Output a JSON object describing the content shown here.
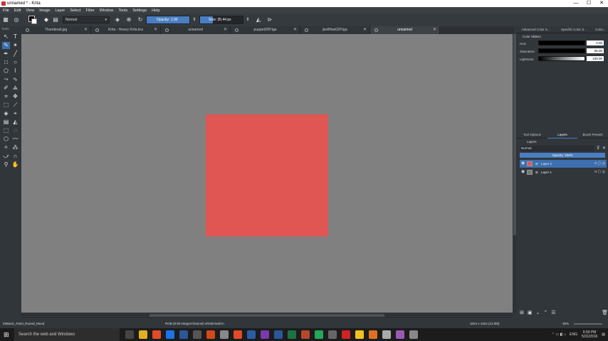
{
  "window": {
    "title": "unnamed * - Krita",
    "minimize": "—",
    "maximize": "☐",
    "close": "✕"
  },
  "menu": [
    "File",
    "Edit",
    "View",
    "Image",
    "Layer",
    "Select",
    "Filter",
    "Window",
    "Tools",
    "Settings",
    "Help"
  ],
  "toolbar": {
    "blend_mode": "Normal",
    "opacity_label": "Opacity:  1.00",
    "opacity_value": 1.0,
    "size_label": "Size:  35.44 px",
    "size_fill": 0.3
  },
  "tabs": [
    {
      "label": "Thumbnail.jpg",
      "active": false
    },
    {
      "label": "Krita - Heavy Krita.kra",
      "active": false
    },
    {
      "label": "unnamed",
      "active": false
    },
    {
      "label": "puppet02P.tga",
      "active": false
    },
    {
      "label": "jbellflow02P.tga",
      "active": false
    },
    {
      "label": "unnamed",
      "active": true
    }
  ],
  "toolbox": {
    "title": "Tools",
    "tools": [
      "cursor",
      "text",
      "brush",
      "multibrush",
      "calligraphy",
      "line",
      "rectangle",
      "ellipse",
      "polygon",
      "polyline",
      "bezier",
      "freehand-path",
      "dynamic-brush",
      "assistant",
      "crop",
      "move",
      "transform",
      "measure",
      "fill",
      "color-picker",
      "gradient",
      "smart-patch",
      "rect-select",
      "ellipse-select",
      "poly-select",
      "outline-select",
      "contiguous-select",
      "similar-select",
      "bezier-select",
      "magnetic-select",
      "zoom",
      "pan"
    ],
    "selected_index": 2
  },
  "canvas": {
    "background": "#808080",
    "document_color": "#df5652"
  },
  "docker_tabs": [
    {
      "label": "Advanced Color S...",
      "active": false
    },
    {
      "label": "Specific Color S...",
      "active": false
    },
    {
      "label": "Color...",
      "active": false
    }
  ],
  "color_sliders": {
    "title": "Color Sliders",
    "rows": [
      {
        "label": "Hue:",
        "value": "0.00"
      },
      {
        "label": "Saturation:",
        "value": "65.00"
      },
      {
        "label": "Lightness:",
        "value": "100.00"
      }
    ]
  },
  "layer_tabs": [
    {
      "label": "Tool Options",
      "active": false
    },
    {
      "label": "Layers",
      "active": true
    },
    {
      "label": "Brush Presets",
      "active": false
    }
  ],
  "layers": {
    "title": "Layers",
    "blend_mode": "Normal",
    "opacity": "Opacity:  100%",
    "items": [
      {
        "name": "Layer 2",
        "selected": true,
        "thumb": "#df5652"
      },
      {
        "name": "Layer 1",
        "selected": false,
        "thumb": "#777777"
      }
    ]
  },
  "status": {
    "brush": "02Basic_Paint_Round_Mood",
    "color_model": "RGB (8-bit integer/channel)  sRGB-built-in",
    "dimensions": "1024 x 1024 (13.0M)",
    "zoom": "36%"
  },
  "taskbar": {
    "search_placeholder": "Search the web and Windows",
    "language": "ENG",
    "time": "6:59 PM",
    "date": "5/31/2016",
    "app_colors": [
      "#444444",
      "#e0b020",
      "#e24a2a",
      "#1a73e8",
      "#2b579a",
      "#555555",
      "#d04a1a",
      "#888888",
      "#e24a2a",
      "#2a5caa",
      "#7a3aaa",
      "#2b579a",
      "#1e7145",
      "#b7472a",
      "#23a85a",
      "#666666",
      "#d22222",
      "#f0c020",
      "#e07020",
      "#aaaaaa",
      "#9b59b6",
      "#888888"
    ]
  }
}
